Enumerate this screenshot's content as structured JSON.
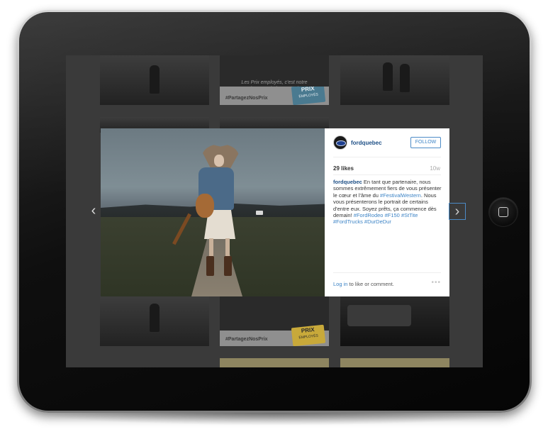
{
  "screen": {
    "tiles": {
      "poster_top_text": "Les Prix employés, c'est notre plus gros événement de l'année.",
      "poster_top_hashtag": "#PartagezNosPrix",
      "poster_bottom_hashtag": "#PartagezNosPrix",
      "prix_badge": "PRIX",
      "prix_badge_sub": "EMPLOYÉS"
    }
  },
  "post": {
    "username": "fordquebec",
    "follow_label": "FOLLOW",
    "likes": "29 likes",
    "time": "10w",
    "caption": {
      "author": "fordquebec",
      "text_1": " En tant que partenaire, nous sommes extrêmement fiers de vous présenter le cœur et l'âme du ",
      "tag_festival": "#FestivalWestern",
      "text_2": ". Nous vous présenterons le portrait de certains d'entre eux. Soyez prêts, ça commence dès demain! ",
      "tags": [
        "#FordRodeo",
        "#F150",
        "#StTite",
        "#FordTrucks",
        "#DurDeDur"
      ]
    },
    "login_link": "Log in",
    "login_rest": " to like or comment.",
    "more_icon": "more-dots-icon",
    "prev_icon": "chevron-left-icon",
    "next_icon": "chevron-right-icon"
  },
  "colors": {
    "link": "#3d84c6",
    "username": "#1d4f86",
    "follow_border": "#4c8bc7"
  }
}
